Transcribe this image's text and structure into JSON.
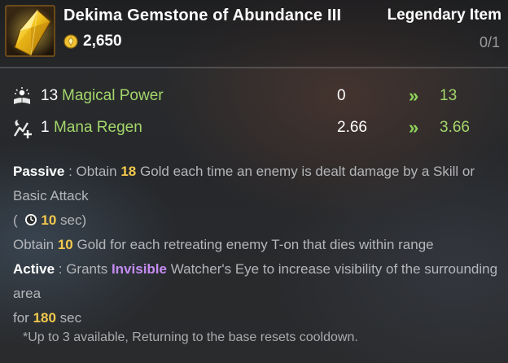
{
  "item": {
    "name": "Dekima Gemstone of Abundance III",
    "price": "2,650",
    "rarity": "Legendary Item",
    "count": "0/1"
  },
  "stats": [
    {
      "icon": "magical-power-icon",
      "base": "13",
      "name": "Magical Power",
      "current": "0",
      "arrow": "»",
      "next": "13"
    },
    {
      "icon": "mana-regen-icon",
      "base": "1",
      "name": "Mana Regen",
      "current": "2.66",
      "arrow": "»",
      "next": "3.66"
    }
  ],
  "passive": {
    "label": "Passive",
    "sep": " : ",
    "t1": "Obtain ",
    "gold": "18",
    "t2": " Gold each time an enemy is dealt damage by a Skill or Basic Attack",
    "paren_open": "( ",
    "cooldown": "10",
    "cooldown_unit": " sec)",
    "line3_a": "Obtain ",
    "line3_gold": "10",
    "line3_b": " Gold for each retreating enemy T-on that dies within range"
  },
  "active": {
    "label": "Active",
    "sep": " : ",
    "t1": "Grants ",
    "effect": "Invisible",
    "t2": " Watcher's Eye to increase visibility of the surrounding area",
    "line2_a": "for ",
    "duration": "180",
    "line2_b": " sec"
  },
  "footnote": "*Up to 3 available, Returning to the base resets cooldown.",
  "colors": {
    "highlight": "#f2c94c",
    "stat_green": "#a3d66a",
    "invisible_purple": "#c48cf2",
    "body_text": "#b4b6b9"
  }
}
